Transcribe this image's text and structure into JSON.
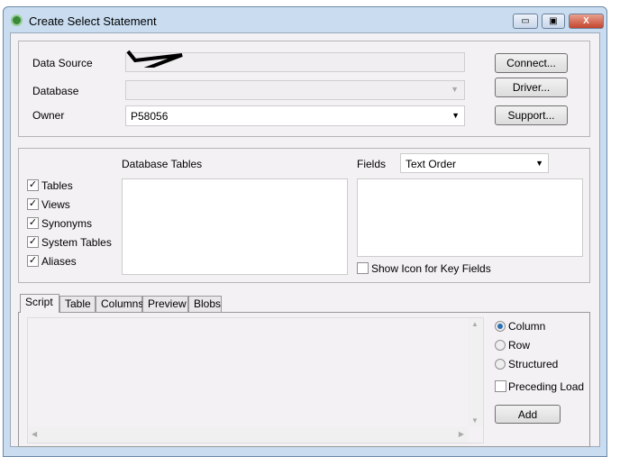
{
  "window": {
    "title": "Create Select Statement",
    "minimize": "▭",
    "maximize": "▣",
    "close": "X"
  },
  "connection": {
    "data_source_label": "Data Source",
    "database_label": "Database",
    "owner_label": "Owner",
    "owner_value": "P58056",
    "connect": "Connect...",
    "driver": "Driver...",
    "support": "Support..."
  },
  "filters": [
    {
      "label": "Tables",
      "checked": true
    },
    {
      "label": "Views",
      "checked": true
    },
    {
      "label": "Synonyms",
      "checked": true
    },
    {
      "label": "System Tables",
      "checked": true
    },
    {
      "label": "Aliases",
      "checked": true
    }
  ],
  "tables": {
    "label": "Database Tables"
  },
  "fields": {
    "label": "Fields",
    "order": "Text Order",
    "show_icon_label": "Show Icon for Key Fields"
  },
  "tabs": [
    "Script",
    "Table",
    "Columns",
    "Preview",
    "Blobs"
  ],
  "options": {
    "column": "Column",
    "row": "Row",
    "structured": "Structured",
    "preceding": "Preceding Load",
    "add": "Add"
  }
}
